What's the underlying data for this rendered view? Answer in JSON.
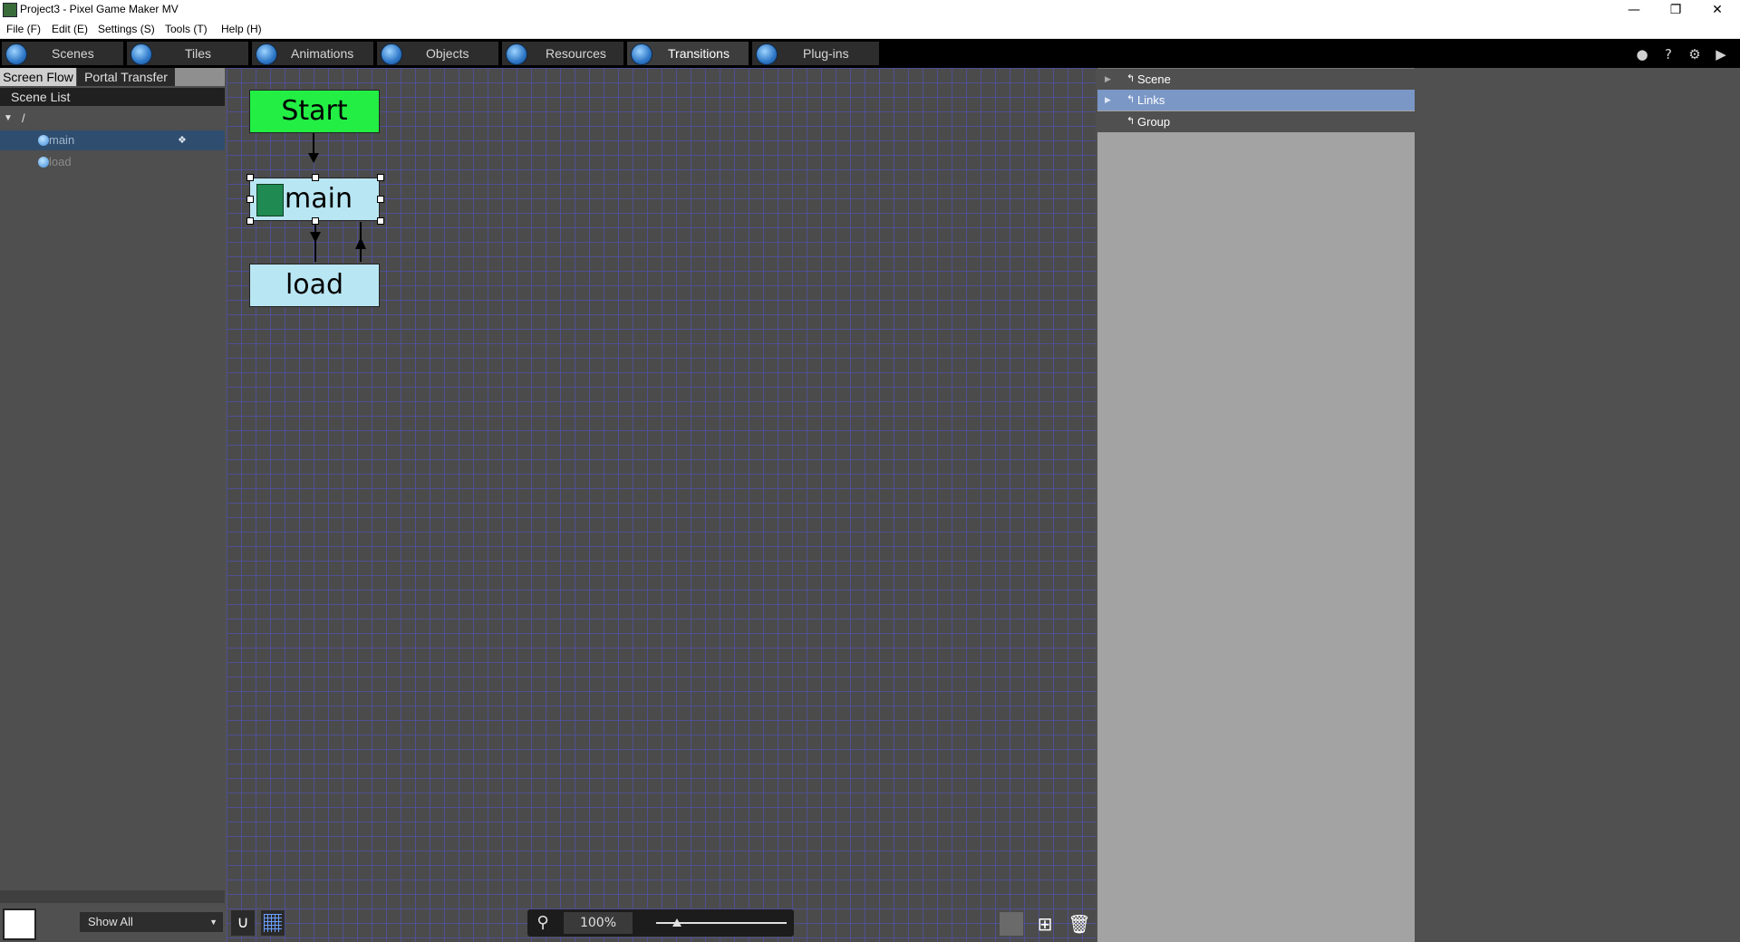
{
  "window": {
    "title": "Project3 - Pixel Game Maker MV"
  },
  "menu": [
    "File (F)",
    "Edit (E)",
    "Settings (S)",
    "Tools (T)",
    "Help (H)"
  ],
  "main_tabs": [
    {
      "label": "Scenes",
      "icon": "scenes-icon"
    },
    {
      "label": "Tiles",
      "icon": "tiles-icon"
    },
    {
      "label": "Animations",
      "icon": "animations-icon"
    },
    {
      "label": "Objects",
      "icon": "objects-icon"
    },
    {
      "label": "Resources",
      "icon": "resources-icon"
    },
    {
      "label": "Transitions",
      "icon": "transitions-icon",
      "active": true
    },
    {
      "label": "Plug-ins",
      "icon": "plugins-icon"
    }
  ],
  "left_panel": {
    "subtabs": [
      "Screen Flow",
      "Portal Transfer"
    ],
    "scene_list_title": "Scene List",
    "root_label": "/",
    "scenes": [
      {
        "label": "main",
        "selected": true
      },
      {
        "label": "load",
        "selected": false
      }
    ],
    "filter_value": "Show All"
  },
  "canvas": {
    "nodes": {
      "start": "Start",
      "main": "main",
      "load": "load"
    },
    "zoom": "100%"
  },
  "right_panel": {
    "sections": [
      "Scene",
      "Links",
      "Group"
    ],
    "highlighted": "Links"
  },
  "colors": {
    "start_node": "#22ee44",
    "scene_node": "#b9e6f3",
    "highlight": "#7a97c6",
    "selected_row": "#2f4d6f"
  }
}
